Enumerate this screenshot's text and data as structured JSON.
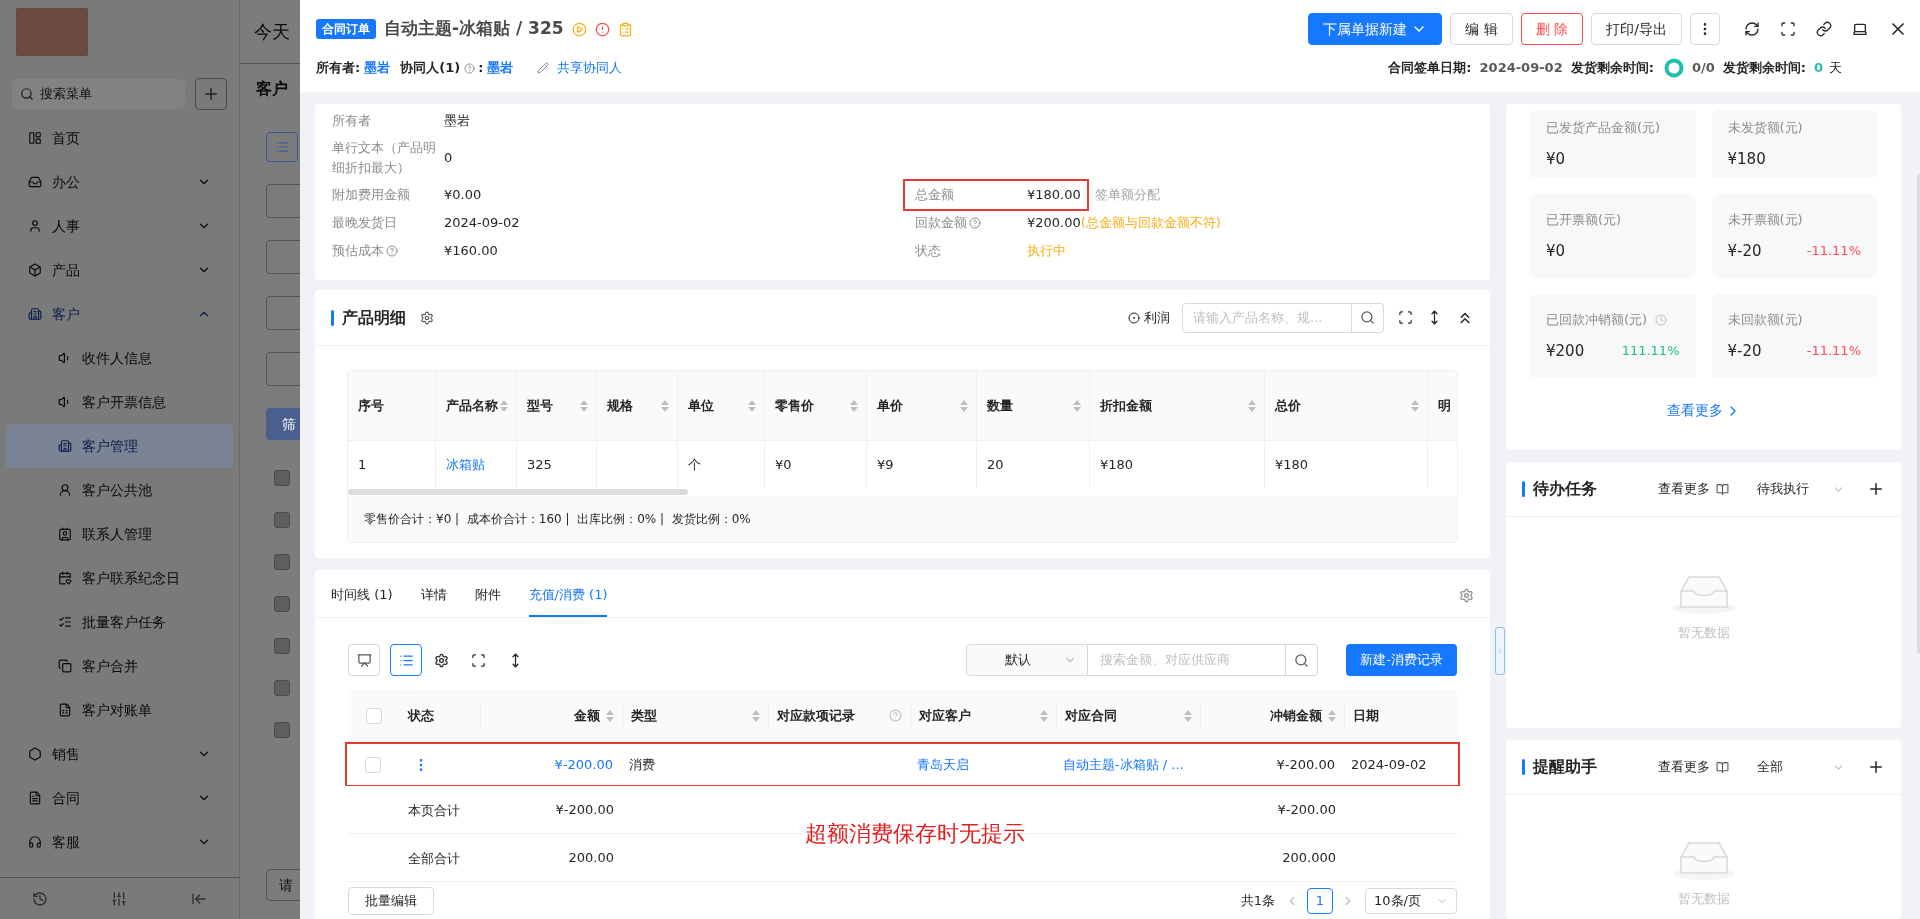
{
  "background_app": {
    "search": {
      "placeholder": "搜索菜单"
    },
    "menu": [
      {
        "label": "首页",
        "expandable": false,
        "expanded": false
      },
      {
        "label": "办公",
        "expandable": true,
        "expanded": false
      },
      {
        "label": "人事",
        "expandable": true,
        "expanded": false
      },
      {
        "label": "产品",
        "expandable": true,
        "expanded": false
      },
      {
        "label": "客户",
        "expandable": true,
        "expanded": true,
        "children": [
          {
            "label": "收件人信息",
            "selected": false
          },
          {
            "label": "客户开票信息",
            "selected": false
          },
          {
            "label": "客户管理",
            "selected": true
          },
          {
            "label": "客户公共池",
            "selected": false
          },
          {
            "label": "联系人管理",
            "selected": false
          },
          {
            "label": "客户联系纪念日",
            "selected": false
          },
          {
            "label": "批量客户任务",
            "selected": false
          },
          {
            "label": "客户合并",
            "selected": false
          },
          {
            "label": "客户对账单",
            "selected": false
          }
        ]
      },
      {
        "label": "销售",
        "expandable": true,
        "expanded": false
      },
      {
        "label": "合同",
        "expandable": true,
        "expanded": false
      },
      {
        "label": "客服",
        "expandable": true,
        "expanded": false
      }
    ],
    "header_text": "今天",
    "page_title": "客户",
    "filter_button": "筛",
    "rows": [
      {
        "checked": false
      },
      {
        "checked": false
      },
      {
        "checked": false
      },
      {
        "checked": false
      },
      {
        "checked": false
      },
      {
        "checked": false
      },
      {
        "checked": false
      }
    ],
    "bottom_field_placeholder": "请"
  },
  "header": {
    "badge": "合同订单",
    "title": "自动主题-冰箱贴 / 325",
    "actions": [
      {
        "label": "下属单据新建",
        "kind": "primary"
      },
      {
        "label": "编 辑",
        "kind": "default"
      },
      {
        "label": "删 除",
        "kind": "danger"
      },
      {
        "label": "打印/导出",
        "kind": "default"
      }
    ],
    "owner_label": "所有者:",
    "owner": "墨岩",
    "collaborator_label": "协同人(1)",
    "collaborator_sep": ":",
    "collaborator": "墨岩",
    "share_link": "共享协同人",
    "meta": [
      {
        "label": "合同签单日期:",
        "value": "2024-09-02",
        "kind": "date"
      },
      {
        "label": "发货剩余时间:",
        "value": "0/0",
        "kind": "ring"
      },
      {
        "label": "发货剩余时间:",
        "value": "0",
        "kind": "days",
        "unit": "天"
      }
    ]
  },
  "info": {
    "left": [
      {
        "label": "所有者",
        "value": "墨岩",
        "help": false
      },
      {
        "label": "单行文本（产品明细折扣最大）",
        "value": "0",
        "help": false
      },
      {
        "label": "附加费用金额",
        "value": "¥0.00",
        "help": false
      },
      {
        "label": "最晚发货日",
        "value": "2024-09-02",
        "help": false
      },
      {
        "label": "预估成本",
        "value": "¥160.00",
        "help": true
      }
    ],
    "right": [
      {
        "label": "总金额",
        "help": false,
        "value": "¥180.00",
        "warning": false,
        "highlighted": true,
        "note": "签单额分配",
        "note_warning": false
      },
      {
        "label": "回款金额",
        "help": true,
        "value": "¥200.00",
        "warning": false,
        "highlighted": false,
        "note": "(总金额与回款金额不符)",
        "note_warning": true
      },
      {
        "label": "状态",
        "help": false,
        "value": "执行中",
        "warning": true,
        "highlighted": false
      }
    ]
  },
  "products": {
    "title": "产品明细",
    "profit_label": "利润",
    "search_placeholder": "请输入产品名称、规...",
    "columns": [
      {
        "label": "序号",
        "sortable": false
      },
      {
        "label": "产品名称",
        "sortable": true
      },
      {
        "label": "型号",
        "sortable": true
      },
      {
        "label": "规格",
        "sortable": true
      },
      {
        "label": "单位",
        "sortable": true
      },
      {
        "label": "零售价",
        "sortable": true
      },
      {
        "label": "单价",
        "sortable": true
      },
      {
        "label": "数量",
        "sortable": true
      },
      {
        "label": "折扣金额",
        "sortable": true
      },
      {
        "label": "总价",
        "sortable": true
      },
      {
        "label": "明",
        "sortable": false
      }
    ],
    "rows": [
      {
        "cells": [
          {
            "kind": "text",
            "text": "1"
          },
          {
            "kind": "link",
            "text": "冰箱贴"
          },
          {
            "kind": "text",
            "text": "325"
          },
          {
            "kind": "empty"
          },
          {
            "kind": "text",
            "text": "个"
          },
          {
            "kind": "text",
            "text": "¥0"
          },
          {
            "kind": "text",
            "text": "¥9"
          },
          {
            "kind": "text",
            "text": "20"
          },
          {
            "kind": "text",
            "text": "¥180"
          },
          {
            "kind": "text",
            "text": "¥180"
          },
          {
            "kind": "empty"
          }
        ]
      }
    ],
    "summary": "零售价合计：¥0 |  成本价合计：160 |  出库比例：0% |  发货比例：0%"
  },
  "records": {
    "tabs": [
      {
        "label": "时间线 (1)",
        "selected": false
      },
      {
        "label": "详情",
        "selected": false
      },
      {
        "label": "附件",
        "selected": false
      },
      {
        "label": "充值/消费 (1)",
        "selected": true
      }
    ],
    "views": [
      {
        "kind": "board",
        "selected": false
      },
      {
        "kind": "list",
        "selected": true
      }
    ],
    "filter": "默认",
    "search_placeholder": "搜索金额、对应供应商",
    "create_button": "新建-消费记录",
    "header_checked": false,
    "columns": [
      {
        "label": "状态",
        "right_aligned": false,
        "sortable": false,
        "help": false
      },
      {
        "label": "金额",
        "right_aligned": true,
        "sortable": true,
        "help": false
      },
      {
        "label": "类型",
        "right_aligned": false,
        "sortable": true,
        "help": false
      },
      {
        "label": "对应款项记录",
        "right_aligned": false,
        "sortable": false,
        "help": true
      },
      {
        "label": "对应客户",
        "right_aligned": false,
        "sortable": true,
        "help": false
      },
      {
        "label": "对应合同",
        "right_aligned": false,
        "sortable": true,
        "help": false
      },
      {
        "label": "冲销金额",
        "right_aligned": true,
        "sortable": true,
        "help": false
      },
      {
        "label": "日期",
        "right_aligned": false,
        "sortable": false,
        "help": false
      }
    ],
    "rows": [
      {
        "checked": false,
        "highlighted": true,
        "cells": [
          {
            "kind": "menu"
          },
          {
            "kind": "link",
            "text": "¥-200.00"
          },
          {
            "kind": "text",
            "text": "消费"
          },
          {
            "kind": "empty"
          },
          {
            "kind": "link",
            "text": "青岛天启"
          },
          {
            "kind": "link",
            "text": "自动主题-冰箱贴 / ..."
          },
          {
            "kind": "text",
            "text": "¥-200.00"
          },
          {
            "kind": "text",
            "text": "2024-09-02"
          }
        ]
      }
    ],
    "totals": [
      {
        "label": "本页合计",
        "amount": "¥-200.00",
        "writeoff": "¥-200.00"
      },
      {
        "label": "全部合计",
        "amount": "200.00",
        "writeoff": "200.000"
      }
    ],
    "annotation": "超额消费保存时无提示",
    "batch_button": "批量编辑",
    "total_count": "共1条",
    "pages": [
      {
        "label": "1",
        "selected": true
      }
    ],
    "page_size": "10条/页"
  },
  "side": {
    "stats": [
      {
        "label": "已发货产品金额(元)",
        "value": "¥0",
        "history_icon": false
      },
      {
        "label": "未发货额(元)",
        "value": "¥180",
        "history_icon": false
      },
      {
        "label": "已开票额(元)",
        "value": "¥0",
        "history_icon": false
      },
      {
        "label": "未开票额(元)",
        "value": "¥-20",
        "change": "-11.11%",
        "positive": false,
        "history_icon": false
      },
      {
        "label": "已回款冲销额(元)",
        "value": "¥200",
        "change": "111.11%",
        "positive": true,
        "history_icon": true
      },
      {
        "label": "未回款额(元)",
        "value": "¥-20",
        "change": "-11.11%",
        "positive": false,
        "history_icon": false
      }
    ],
    "more_link": "查看更多",
    "panels": [
      {
        "title": "待办任务",
        "more": "查看更多",
        "filter": "待我执行",
        "empty": "暂无数据"
      },
      {
        "title": "提醒助手",
        "more": "查看更多",
        "filter": "全部",
        "empty": "暂无数据"
      }
    ]
  }
}
